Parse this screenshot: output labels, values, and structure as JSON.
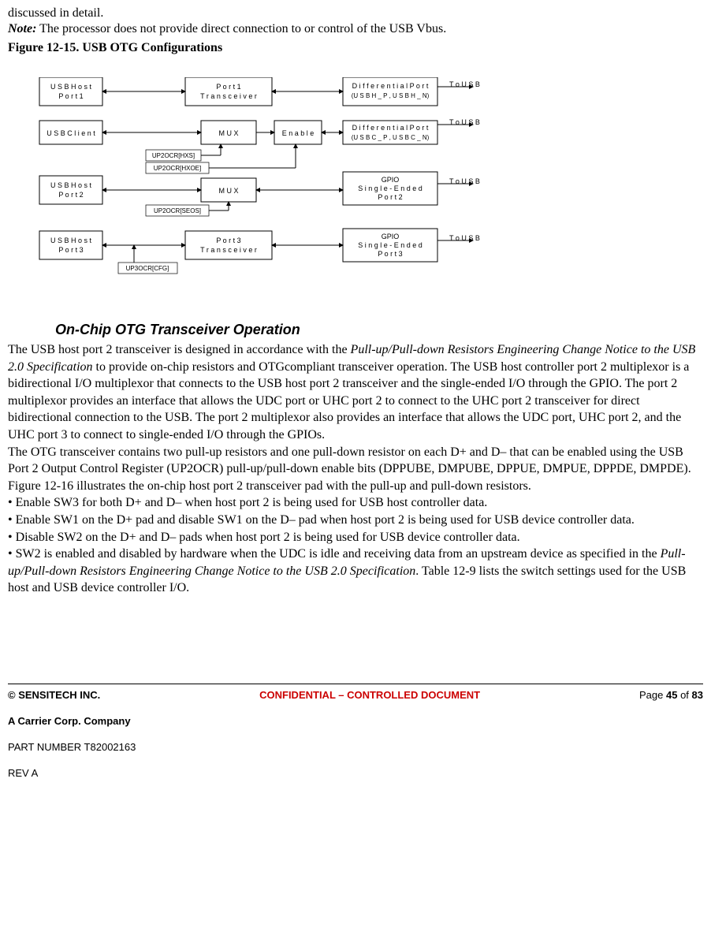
{
  "intro": {
    "discussed": "discussed in detail.",
    "note_label": "Note:",
    "note_text": " The processor does not provide direct connection to or control of the USB Vbus."
  },
  "figure_title": "Figure 12-15. USB OTG Configurations",
  "diagram": {
    "usbhost1": "USBHost\nPort 1",
    "port1_trans": "Port 1\nTransceiver",
    "diffport1": "DifferentialPort\n(USBH_P,USBH_N)",
    "to_usb": "To USB",
    "usbclient": "USBClient",
    "mux": "MUX",
    "enable": "Enable",
    "diffport2": "DifferentialPort\n(USBC_P,USBC_N)",
    "usbhost2": "USBHost\nPort 2",
    "gpio2": "GPIO\nSingle-Ended\nPort 2",
    "usbhost3": "USBHost\nPort 3",
    "port3_trans": "Port 3\nTransceiver",
    "gpio3": "GPIO\nSingle-Ended\nPort 3",
    "sig_hxs": "UP2OCR[HXS]",
    "sig_hxoe": "UP2OCR[HXOE]",
    "sig_seos": "UP2OCR[SEOS]",
    "sig_cfg": "UP3OCR[CFG]"
  },
  "section_heading": "On-Chip OTG Transceiver Operation",
  "para": {
    "p1a": "The USB host port 2 transceiver is designed in accordance with the ",
    "p1b_italic": "Pull-up/Pull-down Resistors Engineering Change Notice to the USB 2.0 Specification",
    "p1c": " to provide on-chip resistors and OTGcompliant transceiver operation. The USB host controller port 2 multiplexor is a bidirectional I/O multiplexor that connects to the USB host port 2 transceiver and the single-ended I/O through the GPIO. The port 2 multiplexor provides an interface that allows the UDC port or UHC port 2 to connect to the UHC port 2 transceiver for direct bidirectional connection to the USB. The port 2 multiplexor also provides an interface that allows the UDC port, UHC port 2, and the UHC port 3 to connect to single-ended I/O through the GPIOs.",
    "p2": "The OTG transceiver contains two pull-up resistors and one pull-down resistor on each D+ and D– that can be enabled using the USB Port 2 Output Control Register (UP2OCR) pull-up/pull-down enable bits (DPPUBE, DMPUBE, DPPUE, DMPUE, DPPDE, DMPDE). Figure 12-16 illustrates the on-chip host port 2 transceiver pad with the pull-up and pull-down resistors.",
    "b1": "• Enable SW3 for both D+ and D– when host port 2 is being used for USB host controller data.",
    "b2": "• Enable SW1 on the D+ pad and disable SW1 on the D– pad when host port 2 is being used for USB device controller data.",
    "b3": "• Disable SW2 on the D+ and D– pads when host port 2 is being used for USB device controller data.",
    "b4a": "• SW2 is enabled and disabled by hardware when the UDC is idle and receiving data from an upstream device as specified in the ",
    "b4b_italic": "Pull-up/Pull-down Resistors Engineering Change Notice to the USB 2.0 Specification",
    "b4c": ". Table 12-9 lists the switch settings used for the USB host and USB device controller I/O."
  },
  "footer": {
    "company": "© SENSITECH INC.",
    "confidential": "CONFIDENTIAL – CONTROLLED DOCUMENT",
    "page_a": "Page ",
    "page_b": "45",
    "page_c": " of ",
    "page_d": "83",
    "carrier": "A Carrier Corp. Company",
    "partnum": "PART NUMBER T82002163",
    "rev": "REV A"
  }
}
